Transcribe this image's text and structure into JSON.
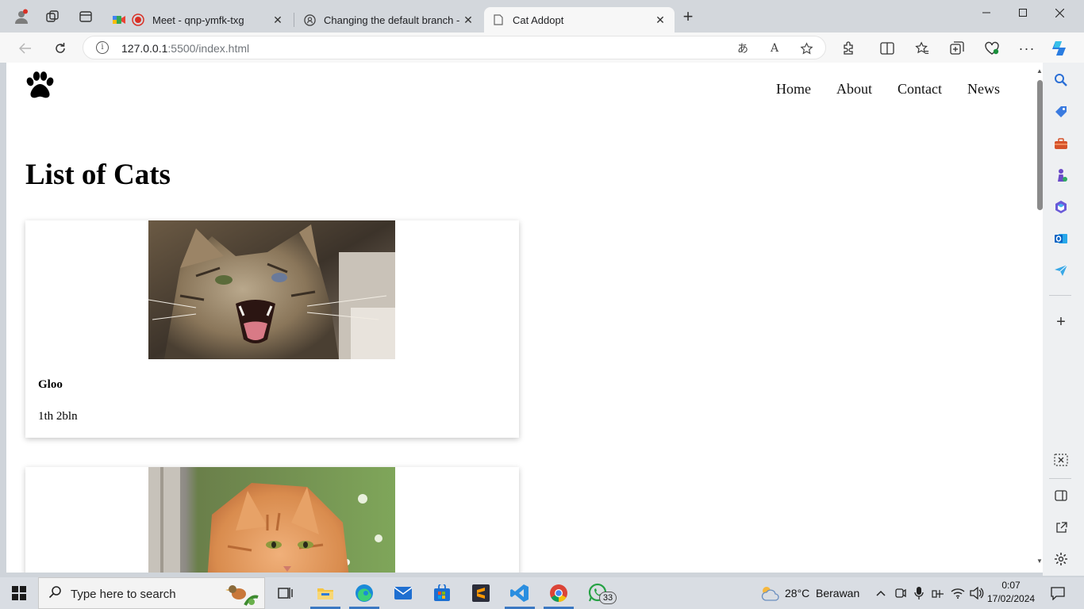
{
  "browser": {
    "tabs": [
      {
        "title": "Meet - qnp-ymfk-txg",
        "favicon": "google-meet-icon"
      },
      {
        "title": "Changing the default branch - Gi",
        "favicon": "github-icon"
      },
      {
        "title": "Cat Addopt",
        "favicon": "page-icon"
      }
    ],
    "url_host": "127.0.0.1",
    "url_rest": ":5500/index.html"
  },
  "site": {
    "nav": {
      "home": "Home",
      "about": "About",
      "contact": "Contact",
      "news": "News"
    },
    "title": "List of Cats",
    "cats": [
      {
        "name": "Gloo",
        "age": "1th 2bln"
      },
      {
        "name": "",
        "age": ""
      }
    ]
  },
  "taskbar": {
    "search_placeholder": "Type here to search",
    "weather_temp": "28°C",
    "weather_text": "Berawan",
    "time": "0:07",
    "date": "17/02/2024",
    "whatsapp_badge": "33"
  },
  "colors": {
    "accent": "#3b78c2",
    "card_shadow": "#d0d0d0"
  }
}
